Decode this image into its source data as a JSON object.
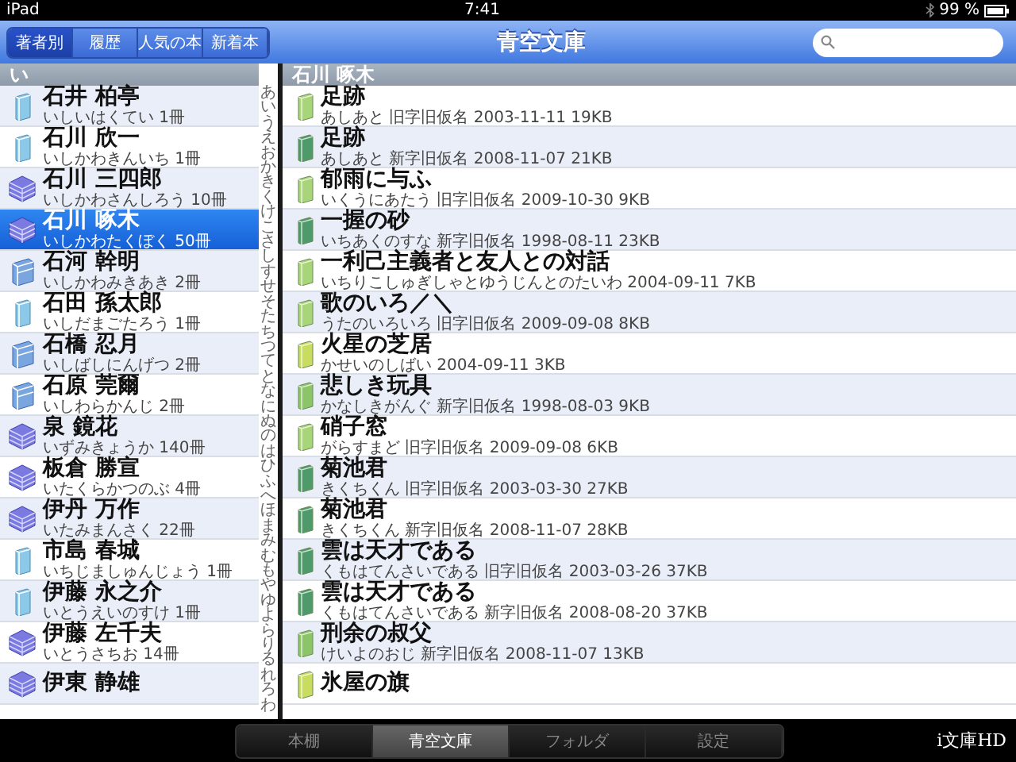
{
  "status_bar": {
    "device": "iPad",
    "time": "7:41",
    "battery": "99 %"
  },
  "nav": {
    "segments": [
      {
        "label": "著者別",
        "selected": true
      },
      {
        "label": "履歴",
        "selected": false
      },
      {
        "label": "人気の本",
        "selected": false
      },
      {
        "label": "新着本",
        "selected": false
      }
    ],
    "title": "青空文庫"
  },
  "authors": {
    "section": "い",
    "items": [
      {
        "name": "石井 柏亭",
        "sub": "いしいはくてい 1冊",
        "kind": "single",
        "selected": false
      },
      {
        "name": "石川 欣一",
        "sub": "いしかわきんいち 1冊",
        "kind": "single",
        "selected": false
      },
      {
        "name": "石川 三四郎",
        "sub": "いしかわさんしろう 10冊",
        "kind": "stack",
        "selected": false
      },
      {
        "name": "石川 啄木",
        "sub": "いしかわたくぼく 50冊",
        "kind": "stack",
        "selected": true
      },
      {
        "name": "石河 幹明",
        "sub": "いしかわみきあき 2冊",
        "kind": "few",
        "selected": false
      },
      {
        "name": "石田 孫太郎",
        "sub": "いしだまごたろう 1冊",
        "kind": "single",
        "selected": false
      },
      {
        "name": "石橋 忍月",
        "sub": "いしばしにんげつ 2冊",
        "kind": "few",
        "selected": false
      },
      {
        "name": "石原 莞爾",
        "sub": "いしわらかんじ 2冊",
        "kind": "few",
        "selected": false
      },
      {
        "name": "泉 鏡花",
        "sub": "いずみきょうか 140冊",
        "kind": "stack",
        "selected": false
      },
      {
        "name": "板倉 勝宣",
        "sub": "いたくらかつのぶ 4冊",
        "kind": "stack",
        "selected": false
      },
      {
        "name": "伊丹 万作",
        "sub": "いたみまんさく 22冊",
        "kind": "stack",
        "selected": false
      },
      {
        "name": "市島 春城",
        "sub": "いちじましゅんじょう 1冊",
        "kind": "single",
        "selected": false
      },
      {
        "name": "伊藤 永之介",
        "sub": "いとうえいのすけ 1冊",
        "kind": "single",
        "selected": false
      },
      {
        "name": "伊藤 左千夫",
        "sub": "いとうさちお 14冊",
        "kind": "stack",
        "selected": false
      },
      {
        "name": "伊東 静雄",
        "kind": "stack",
        "selected": false
      }
    ],
    "index": [
      "あ",
      "い",
      "う",
      "え",
      "お",
      "か",
      "き",
      "く",
      "け",
      "こ",
      "さ",
      "し",
      "す",
      "せ",
      "そ",
      "た",
      "ち",
      "つ",
      "て",
      "と",
      "な",
      "に",
      "ぬ",
      "の",
      "は",
      "ひ",
      "ふ",
      "へ",
      "ほ",
      "ま",
      "み",
      "む",
      "も",
      "や",
      "ゆ",
      "よ",
      "ら",
      "り",
      "る",
      "れ",
      "ろ",
      "わ"
    ]
  },
  "works": {
    "header": "石川 啄木",
    "items": [
      {
        "title": "足跡",
        "sub": "あしあと 旧字旧仮名 2003-11-11 19KB",
        "color": "#a8d47a"
      },
      {
        "title": "足跡",
        "sub": "あしあと 新字旧仮名 2008-11-07 21KB",
        "color": "#4f9a6a"
      },
      {
        "title": "郁雨に与ふ",
        "sub": "いくうにあたう 旧字旧仮名 2009-10-30 9KB",
        "color": "#a8d47a"
      },
      {
        "title": "一握の砂",
        "sub": "いちあくのすな 新字旧仮名 1998-08-11 23KB",
        "color": "#4f9a6a"
      },
      {
        "title": "一利己主義者と友人との対話",
        "sub": "いちりこしゅぎしゃとゆうじんとのたいわ 2004-09-11 7KB",
        "color": "#a8d47a"
      },
      {
        "title": "歌のいろ／＼",
        "sub": "うたのいろいろ 旧字旧仮名 2009-09-08 8KB",
        "color": "#a8d47a"
      },
      {
        "title": "火星の芝居",
        "sub": "かせいのしばい 2004-09-11 3KB",
        "color": "#c8dc60"
      },
      {
        "title": "悲しき玩具",
        "sub": "かなしきがんぐ 新字旧仮名 1998-08-03 9KB",
        "color": "#8cc46a"
      },
      {
        "title": "硝子窓",
        "sub": "がらすまど 旧字旧仮名 2009-09-08 6KB",
        "color": "#a8d47a"
      },
      {
        "title": "菊池君",
        "sub": "きくちくん 旧字旧仮名 2003-03-30 27KB",
        "color": "#4f9a6a"
      },
      {
        "title": "菊池君",
        "sub": "きくちくん 新字旧仮名 2008-11-07 28KB",
        "color": "#4f9a6a"
      },
      {
        "title": "雲は天才である",
        "sub": "くもはてんさいである 旧字旧仮名 2003-03-26 37KB",
        "color": "#4f9a6a"
      },
      {
        "title": "雲は天才である",
        "sub": "くもはてんさいである 新字旧仮名 2008-08-20 37KB",
        "color": "#4f9a6a"
      },
      {
        "title": "刑余の叔父",
        "sub": "けいよのおじ 新字旧仮名 2008-11-07 13KB",
        "color": "#8cc46a"
      },
      {
        "title": "氷屋の旗",
        "color": "#c8dc60"
      }
    ]
  },
  "tabbar": {
    "tabs": [
      {
        "label": "本棚",
        "selected": false
      },
      {
        "label": "青空文庫",
        "selected": true
      },
      {
        "label": "フォルダ",
        "selected": false
      },
      {
        "label": "設定",
        "selected": false
      }
    ],
    "brand": "i文庫HD"
  }
}
